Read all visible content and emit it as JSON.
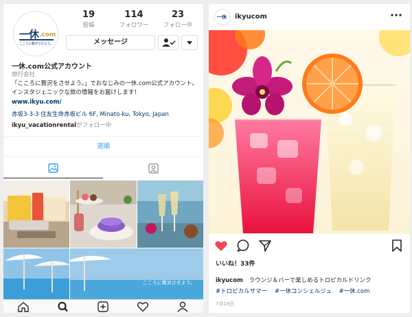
{
  "profile": {
    "logo_mark": "一休",
    "logo_com": ".com",
    "logo_sub": "こころに贅沢させよう。",
    "stats": [
      {
        "num": "19",
        "label": "投稿"
      },
      {
        "num": "114",
        "label": "フォロワー"
      },
      {
        "num": "23",
        "label": "フォロー中"
      }
    ],
    "message_button": "メッセージ",
    "name": "一休.com公式アカウント",
    "category": "旅行会社",
    "bio": "「こころに贅沢をさせよう。」でおなじみの一休.com公式アカウント。インスタジェニックな旅の情報をお届けします！",
    "link": "www.ikyu.com/",
    "address": "赤坂3-3-3 住友生命赤坂ビル 6F, Minato-ku, Tokyo, Japan",
    "followed_by_user": "ikyu_vacationrental",
    "followed_by_suffix": "がフォロー中",
    "directions_button": "道順",
    "grid_overlay_text": "こころに贅沢させよう。"
  },
  "nav_icons": [
    "home-icon",
    "search-icon",
    "add-post-icon",
    "heart-icon",
    "profile-icon"
  ],
  "post": {
    "username": "ikyucom",
    "likes": "いいね！33件",
    "caption_user": "ikyucom",
    "caption_text": "ラウンジ＆バーで楽しめるトロピカルドリンク",
    "hashtags": [
      "#トロピカルサマー",
      "#一休コンシェルジュ",
      "#一休.com"
    ],
    "date": "7月19日"
  },
  "colors": {
    "link": "#003569",
    "action_blue": "#3897f0",
    "like_red": "#ed4956",
    "brand_navy": "#1d3f7a",
    "brand_gold": "#c9a13b"
  }
}
